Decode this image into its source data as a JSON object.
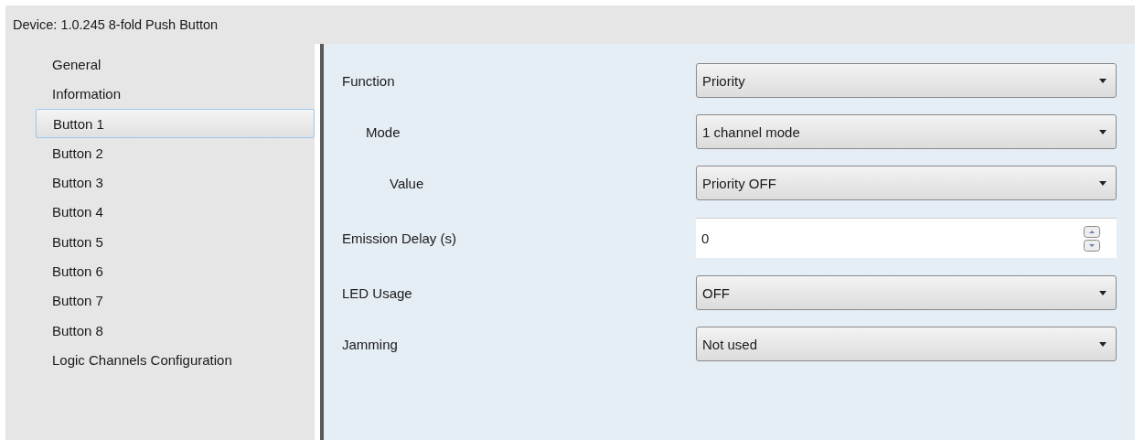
{
  "header": {
    "title": "Device: 1.0.245  8-fold Push Button"
  },
  "sidebar": {
    "items": [
      {
        "label": "General",
        "selected": false
      },
      {
        "label": "Information",
        "selected": false
      },
      {
        "label": "Button 1",
        "selected": true
      },
      {
        "label": "Button 2",
        "selected": false
      },
      {
        "label": "Button 3",
        "selected": false
      },
      {
        "label": "Button 4",
        "selected": false
      },
      {
        "label": "Button 5",
        "selected": false
      },
      {
        "label": "Button 6",
        "selected": false
      },
      {
        "label": "Button 7",
        "selected": false
      },
      {
        "label": "Button 8",
        "selected": false
      },
      {
        "label": "Logic Channels Configuration",
        "selected": false
      }
    ]
  },
  "parameters": [
    {
      "label": "Function",
      "kind": "dropdown",
      "value": "Priority",
      "children": [
        {
          "label": "Mode",
          "kind": "dropdown",
          "value": "1 channel mode",
          "children": [
            {
              "label": "Value",
              "kind": "dropdown",
              "value": "Priority OFF"
            }
          ]
        }
      ]
    },
    {
      "label": "Emission Delay (s)",
      "kind": "spinner",
      "value": "0"
    },
    {
      "label": "LED Usage",
      "kind": "dropdown",
      "value": "OFF"
    },
    {
      "label": "Jamming",
      "kind": "dropdown",
      "value": "Not used"
    }
  ]
}
